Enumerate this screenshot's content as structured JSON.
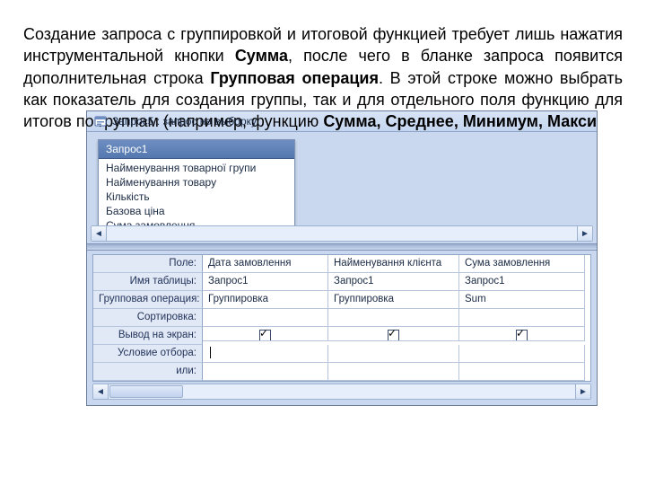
{
  "paragraph": {
    "t1": "Создание запроса с группировкой и итоговой функцией требует лишь нажатия инструментальной кнопки ",
    "b1": "Сумма",
    "t2": ", после чего в бланке запроса появится дополнительная строка ",
    "b2": "Групповая операция",
    "t3": ". В этой строке можно выбрать как показатель для создания группы, так и для отдельного поля функцию для итогов по группам (например, функцию ",
    "b3": "Сумма, Среднее, Минимум, Макси"
  },
  "window": {
    "title": "Запрос5 : запрос на выборку"
  },
  "source_table": {
    "name": "Запрос1",
    "fields": [
      "Найменування товарної групи",
      "Найменування товару",
      "Кількість",
      "Базова ціна",
      "Сума замовлення"
    ]
  },
  "design_rows": {
    "field_label": "Поле:",
    "table_label": "Имя таблицы:",
    "groupop_label": "Групповая операция:",
    "sort_label": "Сортировка:",
    "show_label": "Вывод на экран:",
    "criteria_label": "Условие отбора:",
    "or_label": "или:"
  },
  "columns": [
    {
      "field": "Дата замовлення",
      "table": "Запрос1",
      "groupop": "Группировка",
      "sort": "",
      "show": true,
      "criteria": "",
      "or": ""
    },
    {
      "field": "Найменування клієнта",
      "table": "Запрос1",
      "groupop": "Группировка",
      "sort": "",
      "show": true,
      "criteria": "",
      "or": ""
    },
    {
      "field": "Сума замовлення",
      "table": "Запрос1",
      "groupop": "Sum",
      "sort": "",
      "show": true,
      "criteria": "",
      "or": ""
    }
  ]
}
